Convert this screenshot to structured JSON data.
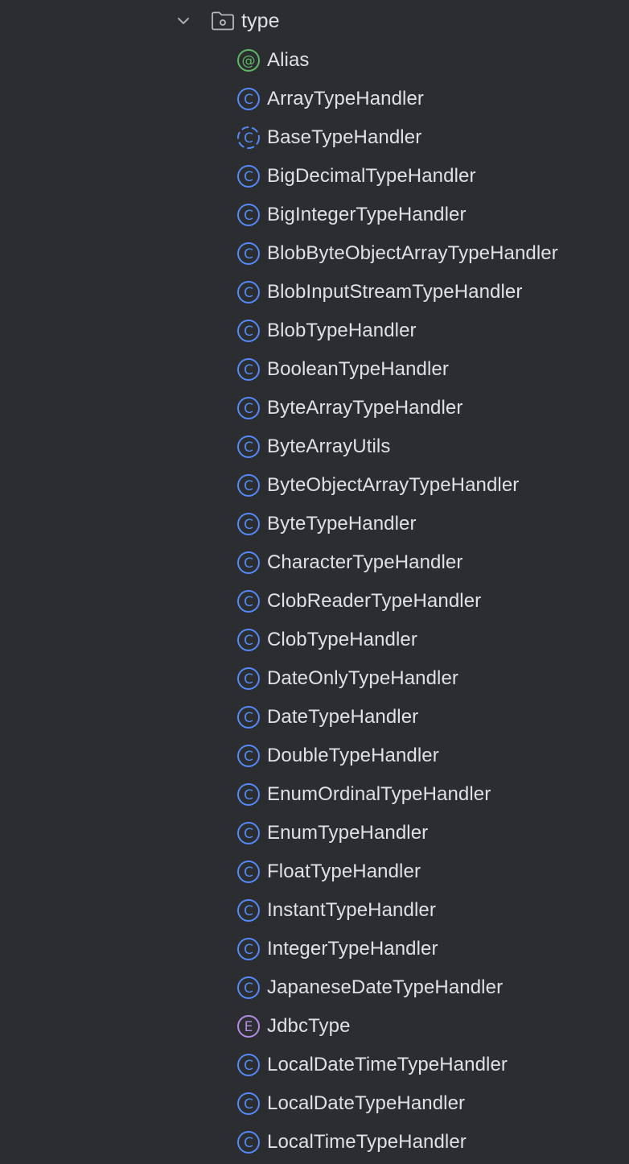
{
  "folder": {
    "label": "type",
    "icon": "package-folder-icon",
    "expanded": true
  },
  "colors": {
    "background": "#2b2d30",
    "text": "#dfe1e5",
    "class_icon": "#548af7",
    "annotation_icon": "#5fb865",
    "enum_icon": "#b38be6"
  },
  "items": [
    {
      "label": "Alias",
      "kind": "annotation",
      "icon": "annotation-icon"
    },
    {
      "label": "ArrayTypeHandler",
      "kind": "class",
      "icon": "class-icon"
    },
    {
      "label": "BaseTypeHandler",
      "kind": "abstract-class",
      "icon": "abstract-class-icon"
    },
    {
      "label": "BigDecimalTypeHandler",
      "kind": "class",
      "icon": "class-icon"
    },
    {
      "label": "BigIntegerTypeHandler",
      "kind": "class",
      "icon": "class-icon"
    },
    {
      "label": "BlobByteObjectArrayTypeHandler",
      "kind": "class",
      "icon": "class-icon"
    },
    {
      "label": "BlobInputStreamTypeHandler",
      "kind": "class",
      "icon": "class-icon"
    },
    {
      "label": "BlobTypeHandler",
      "kind": "class",
      "icon": "class-icon"
    },
    {
      "label": "BooleanTypeHandler",
      "kind": "class",
      "icon": "class-icon"
    },
    {
      "label": "ByteArrayTypeHandler",
      "kind": "class",
      "icon": "class-icon"
    },
    {
      "label": "ByteArrayUtils",
      "kind": "class",
      "icon": "class-icon"
    },
    {
      "label": "ByteObjectArrayTypeHandler",
      "kind": "class",
      "icon": "class-icon"
    },
    {
      "label": "ByteTypeHandler",
      "kind": "class",
      "icon": "class-icon"
    },
    {
      "label": "CharacterTypeHandler",
      "kind": "class",
      "icon": "class-icon"
    },
    {
      "label": "ClobReaderTypeHandler",
      "kind": "class",
      "icon": "class-icon"
    },
    {
      "label": "ClobTypeHandler",
      "kind": "class",
      "icon": "class-icon"
    },
    {
      "label": "DateOnlyTypeHandler",
      "kind": "class",
      "icon": "class-icon"
    },
    {
      "label": "DateTypeHandler",
      "kind": "class",
      "icon": "class-icon"
    },
    {
      "label": "DoubleTypeHandler",
      "kind": "class",
      "icon": "class-icon"
    },
    {
      "label": "EnumOrdinalTypeHandler",
      "kind": "class",
      "icon": "class-icon"
    },
    {
      "label": "EnumTypeHandler",
      "kind": "class",
      "icon": "class-icon"
    },
    {
      "label": "FloatTypeHandler",
      "kind": "class",
      "icon": "class-icon"
    },
    {
      "label": "InstantTypeHandler",
      "kind": "class",
      "icon": "class-icon"
    },
    {
      "label": "IntegerTypeHandler",
      "kind": "class",
      "icon": "class-icon"
    },
    {
      "label": "JapaneseDateTypeHandler",
      "kind": "class",
      "icon": "class-icon"
    },
    {
      "label": "JdbcType",
      "kind": "enum",
      "icon": "enum-icon"
    },
    {
      "label": "LocalDateTimeTypeHandler",
      "kind": "class",
      "icon": "class-icon"
    },
    {
      "label": "LocalDateTypeHandler",
      "kind": "class",
      "icon": "class-icon"
    },
    {
      "label": "LocalTimeTypeHandler",
      "kind": "class",
      "icon": "class-icon"
    }
  ]
}
